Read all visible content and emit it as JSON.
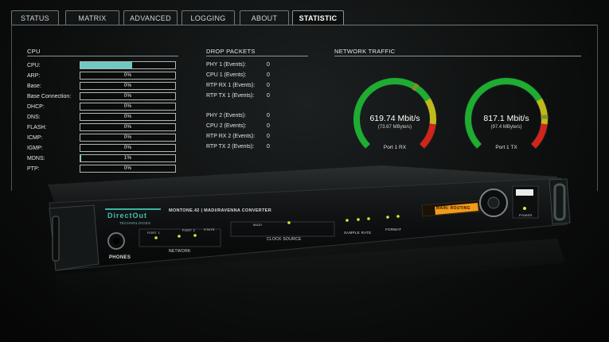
{
  "tabs": [
    {
      "label": "STATUS",
      "active": false
    },
    {
      "label": "MATRIX",
      "active": false
    },
    {
      "label": "ADVANCED",
      "active": false
    },
    {
      "label": "LOGGING",
      "active": false
    },
    {
      "label": "ABOUT",
      "active": false
    },
    {
      "label": "STATISTIC",
      "active": true
    }
  ],
  "cpu": {
    "title": "CPU",
    "rows": [
      {
        "label": "CPU:",
        "value": "",
        "fill": 0.55
      },
      {
        "label": "ARP:",
        "value": "0%",
        "fill": 0
      },
      {
        "label": "Base:",
        "value": "0%",
        "fill": 0
      },
      {
        "label": "Base Connection:",
        "value": "0%",
        "fill": 0
      },
      {
        "label": "DHCP:",
        "value": "0%",
        "fill": 0
      },
      {
        "label": "DNS:",
        "value": "0%",
        "fill": 0
      },
      {
        "label": "FLASH:",
        "value": "0%",
        "fill": 0
      },
      {
        "label": "ICMP:",
        "value": "0%",
        "fill": 0
      },
      {
        "label": "IGMP:",
        "value": "0%",
        "fill": 0
      },
      {
        "label": "MDNS:",
        "value": "1%",
        "fill": 0.01
      },
      {
        "label": "PTP:",
        "value": "0%",
        "fill": 0
      }
    ]
  },
  "drop_packets": {
    "title": "DROP PACKETS",
    "group1": [
      {
        "label": "PHY 1 (Events):",
        "value": "0"
      },
      {
        "label": "CPU 1 (Events):",
        "value": "0"
      },
      {
        "label": "RTP RX 1 (Events):",
        "value": "0"
      },
      {
        "label": "RTP TX 1 (Events):",
        "value": "0"
      }
    ],
    "group2": [
      {
        "label": "PHY 2 (Events):",
        "value": "0"
      },
      {
        "label": "CPU 2 (Events):",
        "value": "0"
      },
      {
        "label": "RTP RX 2 (Events):",
        "value": "0"
      },
      {
        "label": "RTP TX 2 (Events):",
        "value": "0"
      }
    ]
  },
  "network_traffic": {
    "title": "NETWORK TRAFFIC",
    "gauges": [
      {
        "value": "619.74 Mbit/s",
        "sub": "(73.67 MByte/s)",
        "name": "Port 1 RX",
        "level": 0.62
      },
      {
        "value": "817.1 Mbit/s",
        "sub": "(97.4 MByte/s)",
        "name": "Port 1 TX",
        "level": 0.82
      }
    ]
  },
  "device": {
    "brand": "DirectOut",
    "brand_sub": "TECHNOLOGIES",
    "model": "MONTONE.42 | MADI/RAVENNA CONVERTER",
    "phones": "PHONES",
    "network": "NETWORK",
    "clock_source": "CLOCK SOURCE",
    "sample_rate": "SAMPLE RATE",
    "format": "FORMAT",
    "power": "POWER",
    "port1": "PORT 1",
    "port2": "PORT 2",
    "state": "STATE",
    "madi": "MADI",
    "display_text": "MAIN: ROUTING"
  },
  "colors": {
    "accent": "#6fc8c2",
    "gauge_green": "#1fb533",
    "gauge_yellow": "#c9c21a",
    "gauge_red": "#d8261d",
    "display_orange": "#f29a1a"
  }
}
